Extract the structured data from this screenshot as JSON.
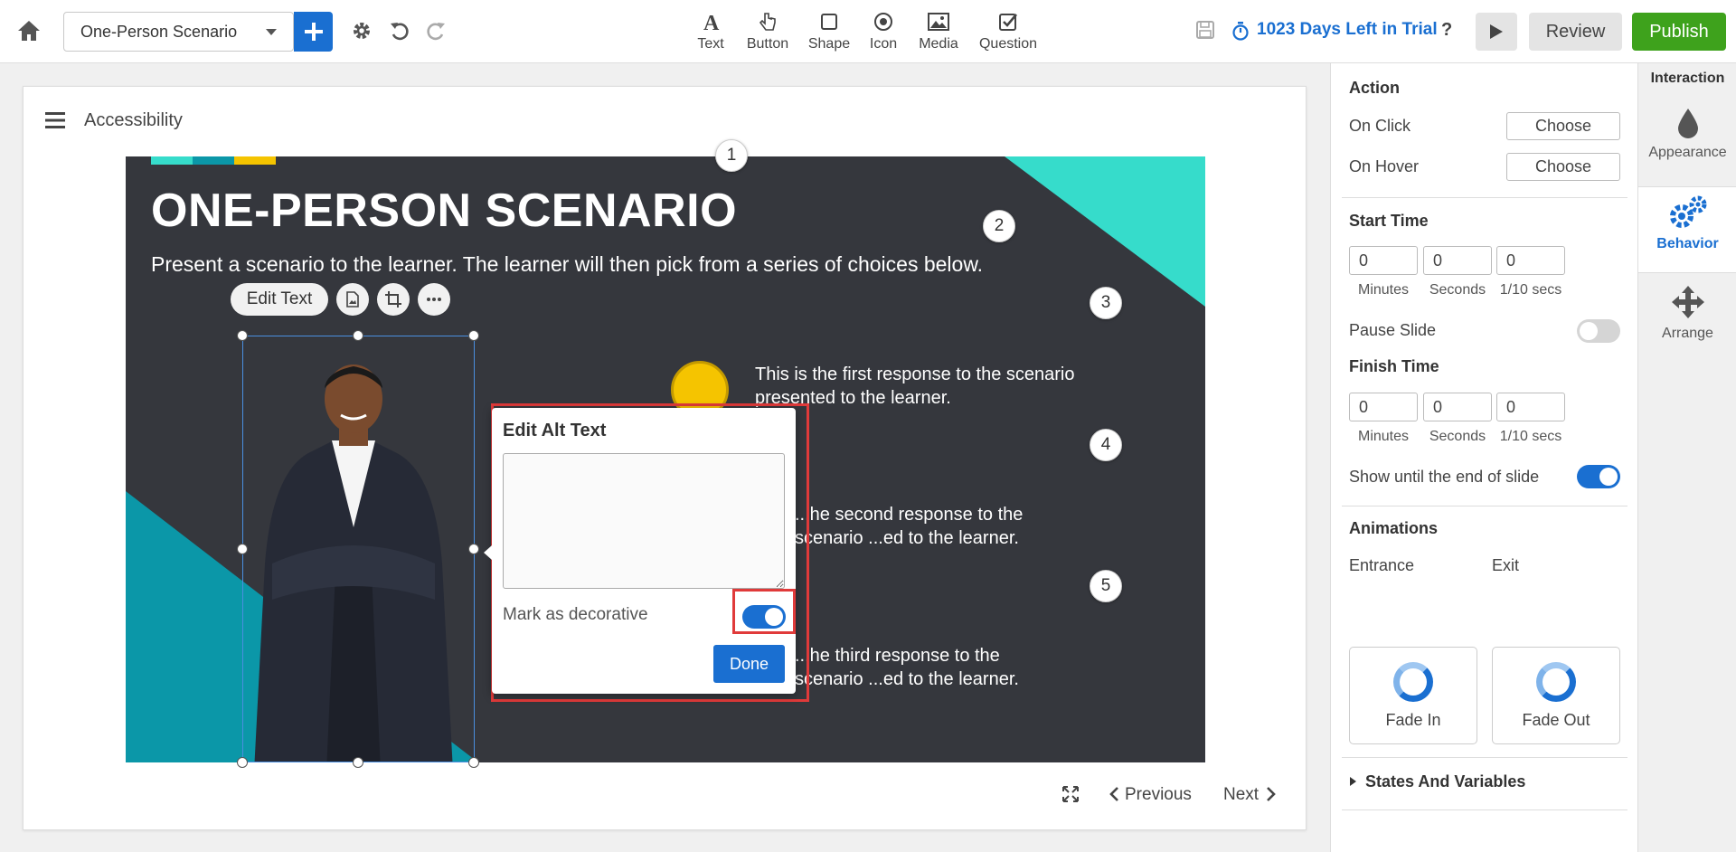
{
  "toolbar": {
    "scenario_select_value": "One-Person Scenario",
    "insert_tools": [
      {
        "label": "Text",
        "icon": "text-icon"
      },
      {
        "label": "Button",
        "icon": "pointer-hand-icon"
      },
      {
        "label": "Shape",
        "icon": "square-icon"
      },
      {
        "label": "Icon",
        "icon": "target-icon"
      },
      {
        "label": "Media",
        "icon": "image-icon"
      },
      {
        "label": "Question",
        "icon": "checkbox-icon"
      }
    ],
    "trial_text": "1023 Days Left in Trial",
    "help_label": "?",
    "review_label": "Review",
    "publish_label": "Publish",
    "colors": {
      "primary": "#1a6fd1",
      "publish": "#3ea21c"
    }
  },
  "canvas": {
    "title": "Accessibility",
    "slide": {
      "heading": "ONE-PERSON SCENARIO",
      "subtitle": "Present a scenario to the learner. The learner will then pick from a series of choices below.",
      "responses": [
        "This is the first response to the scenario presented to the learner.",
        "...he second response to the scenario ...ed to the learner.",
        "...he third response to the scenario ...ed to the learner."
      ],
      "colors": {
        "background": "#35373d",
        "teal": "#36dccb",
        "dark_teal": "#0b97a8",
        "yellow": "#f5c400"
      }
    },
    "edit_toolbar": {
      "edit_text_label": "Edit Text"
    },
    "badges": [
      "1",
      "2",
      "3",
      "4",
      "5"
    ],
    "alt_popup": {
      "title": "Edit Alt Text",
      "textarea_value": "",
      "decorative_label": "Mark as decorative",
      "decorative_on": true,
      "done_label": "Done"
    },
    "footer": {
      "previous_label": "Previous",
      "next_label": "Next"
    }
  },
  "properties": {
    "action": {
      "title": "Action",
      "on_click_label": "On Click",
      "on_hover_label": "On Hover",
      "choose_label": "Choose"
    },
    "start_time": {
      "title": "Start Time",
      "minutes": "0",
      "seconds": "0",
      "tenths": "0",
      "minutes_label": "Minutes",
      "seconds_label": "Seconds",
      "tenths_label": "1/10 secs"
    },
    "pause_slide": {
      "label": "Pause Slide",
      "on": false
    },
    "finish_time": {
      "title": "Finish Time",
      "minutes": "0",
      "seconds": "0",
      "tenths": "0",
      "minutes_label": "Minutes",
      "seconds_label": "Seconds",
      "tenths_label": "1/10 secs"
    },
    "show_until_end": {
      "label": "Show until the end of slide",
      "on": true
    },
    "animations": {
      "title": "Animations",
      "entrance_label": "Entrance",
      "exit_label": "Exit",
      "entrance_value": "Fade In",
      "exit_value": "Fade Out"
    },
    "states_title": "States And Variables"
  },
  "tabs": {
    "header": "Interaction",
    "items": [
      {
        "label": "Appearance",
        "icon": "droplet-icon",
        "active": false
      },
      {
        "label": "Behavior",
        "icon": "gears-icon",
        "active": true
      },
      {
        "label": "Arrange",
        "icon": "move-arrows-icon",
        "active": false
      }
    ]
  }
}
